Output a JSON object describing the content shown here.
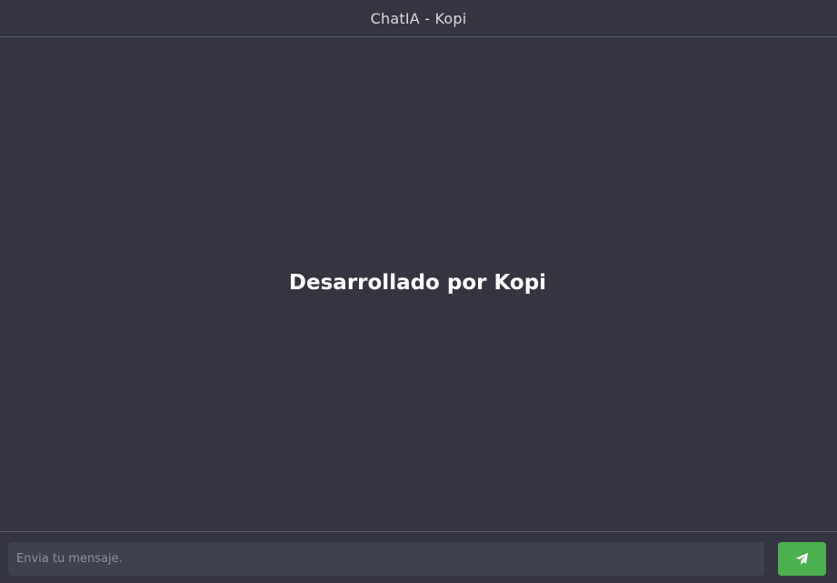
{
  "header": {
    "title": "ChatIA - Kopi"
  },
  "main": {
    "title": "Desarrollado por Kopi"
  },
  "composer": {
    "placeholder": "Envia tu mensaje.",
    "value": "",
    "send_icon": "paper-plane-icon"
  },
  "colors": {
    "background": "#343541",
    "input_background": "#40414f",
    "send_button": "#4caf50",
    "divider": "#5c5d6a"
  }
}
